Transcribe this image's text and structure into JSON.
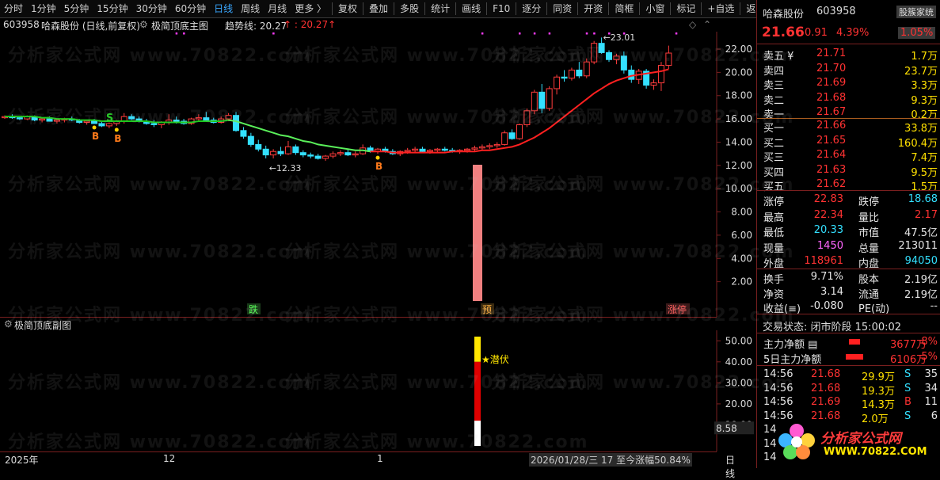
{
  "toolbar": {
    "items": [
      "分时",
      "1分钟",
      "5分钟",
      "15分钟",
      "30分钟",
      "60分钟",
      "日线",
      "周线",
      "月线",
      "更多 〉",
      "复权",
      "叠加",
      "多股",
      "统计",
      "画线",
      "F10",
      "逐分",
      "同资",
      "开资",
      "简框",
      "小窗",
      "标记",
      "+自选",
      "返回"
    ],
    "active_index": 6
  },
  "main_header": {
    "code": "603958",
    "name": "哈森股份 (日线,前复权)",
    "indicator": "极简顶底主图",
    "line_label": "趋势线: 20.27",
    "line_value": "↑ : 20.27↑"
  },
  "chart_data": [
    {
      "type": "candlestick",
      "title": "极简顶底主图",
      "ylim": [
        0,
        23.5
      ],
      "y_ticks": [
        "22.00",
        "20.00",
        "18.00",
        "16.00",
        "14.00",
        "12.00",
        "10.00",
        "8.00",
        "6.00",
        "4.00",
        "2.00"
      ],
      "y_tick_values": [
        22,
        20,
        18,
        16,
        14,
        12,
        10,
        8,
        6,
        4,
        2
      ],
      "candles": [
        [
          16.1,
          16.3,
          16.0,
          16.2
        ],
        [
          16.2,
          16.4,
          16.0,
          16.1
        ],
        [
          16.1,
          16.2,
          15.9,
          16.0
        ],
        [
          16.0,
          16.3,
          15.9,
          16.2
        ],
        [
          16.2,
          16.3,
          15.8,
          15.9
        ],
        [
          15.9,
          16.1,
          15.7,
          16.0
        ],
        [
          16.0,
          16.2,
          15.8,
          15.8
        ],
        [
          15.8,
          16.0,
          15.6,
          15.9
        ],
        [
          15.9,
          16.1,
          15.7,
          16.0
        ],
        [
          16.0,
          16.2,
          15.8,
          15.9
        ],
        [
          15.9,
          16.0,
          15.6,
          15.7
        ],
        [
          15.7,
          15.9,
          15.5,
          15.8
        ],
        [
          15.8,
          16.0,
          15.6,
          15.6
        ],
        [
          15.6,
          15.8,
          15.3,
          15.4
        ],
        [
          15.4,
          15.7,
          15.2,
          15.6
        ],
        [
          15.6,
          15.9,
          15.4,
          15.8
        ],
        [
          15.8,
          16.5,
          15.6,
          16.2
        ],
        [
          16.2,
          16.4,
          15.9,
          16.0
        ],
        [
          16.0,
          16.2,
          15.7,
          15.8
        ],
        [
          15.8,
          16.0,
          15.5,
          15.6
        ],
        [
          15.6,
          15.9,
          15.3,
          15.5
        ],
        [
          15.5,
          15.8,
          15.2,
          15.7
        ],
        [
          15.7,
          16.4,
          15.5,
          15.9
        ],
        [
          15.9,
          16.2,
          15.6,
          15.8
        ],
        [
          15.8,
          16.0,
          15.5,
          15.6
        ],
        [
          15.6,
          16.1,
          15.5,
          16.0
        ],
        [
          16.0,
          16.4,
          15.8,
          16.1
        ],
        [
          16.1,
          16.6,
          15.9,
          15.9
        ],
        [
          15.9,
          16.1,
          15.6,
          15.7
        ],
        [
          15.7,
          16.2,
          15.6,
          16.0
        ],
        [
          16.0,
          16.5,
          15.8,
          16.3
        ],
        [
          16.3,
          16.6,
          14.9,
          15.0
        ],
        [
          15.0,
          15.3,
          14.3,
          14.5
        ],
        [
          14.5,
          14.8,
          13.6,
          13.8
        ],
        [
          13.8,
          14.2,
          13.2,
          13.4
        ],
        [
          13.4,
          13.7,
          12.6,
          12.9
        ],
        [
          12.9,
          13.4,
          12.6,
          13.2
        ],
        [
          13.2,
          13.6,
          12.8,
          13.0
        ],
        [
          13.0,
          14.1,
          12.9,
          13.6
        ],
        [
          13.6,
          13.8,
          12.9,
          13.1
        ],
        [
          13.1,
          13.3,
          12.7,
          12.9
        ],
        [
          12.9,
          13.1,
          12.6,
          12.8
        ],
        [
          12.8,
          13.0,
          12.5,
          12.6
        ],
        [
          12.6,
          12.9,
          12.4,
          12.8
        ],
        [
          12.8,
          13.2,
          12.6,
          13.0
        ],
        [
          13.0,
          13.3,
          12.8,
          13.1
        ],
        [
          13.1,
          13.4,
          12.8,
          12.9
        ],
        [
          12.9,
          13.2,
          12.7,
          13.0
        ],
        [
          13.0,
          13.8,
          12.9,
          13.5
        ],
        [
          13.5,
          13.7,
          13.1,
          13.2
        ],
        [
          13.2,
          13.5,
          13.0,
          13.4
        ],
        [
          13.4,
          13.6,
          13.1,
          13.2
        ],
        [
          13.2,
          13.4,
          12.9,
          13.0
        ],
        [
          13.0,
          13.3,
          12.8,
          13.2
        ],
        [
          13.2,
          13.5,
          13.0,
          13.3
        ],
        [
          13.3,
          13.6,
          13.1,
          13.4
        ],
        [
          13.4,
          13.6,
          13.1,
          13.2
        ],
        [
          13.2,
          13.4,
          13.0,
          13.3
        ],
        [
          13.3,
          13.5,
          13.1,
          13.4
        ],
        [
          13.4,
          13.6,
          13.2,
          13.3
        ],
        [
          13.3,
          13.5,
          13.1,
          13.2
        ],
        [
          13.2,
          13.4,
          13.0,
          13.3
        ],
        [
          13.3,
          13.5,
          13.1,
          13.4
        ],
        [
          13.4,
          13.7,
          13.2,
          13.5
        ],
        [
          13.5,
          13.8,
          13.3,
          13.6
        ],
        [
          13.6,
          13.9,
          13.4,
          13.7
        ],
        [
          13.7,
          14.0,
          13.5,
          13.8
        ],
        [
          13.8,
          15.0,
          13.7,
          14.8
        ],
        [
          14.8,
          15.1,
          14.2,
          14.3
        ],
        [
          14.3,
          15.6,
          14.2,
          15.5
        ],
        [
          15.5,
          16.9,
          15.3,
          16.7
        ],
        [
          16.7,
          18.5,
          16.4,
          18.3
        ],
        [
          18.3,
          19.0,
          16.5,
          16.9
        ],
        [
          16.9,
          18.8,
          16.7,
          18.6
        ],
        [
          18.6,
          19.8,
          18.1,
          19.6
        ],
        [
          19.6,
          20.2,
          19.2,
          19.5
        ],
        [
          19.5,
          20.4,
          19.3,
          20.2
        ],
        [
          20.2,
          20.9,
          19.5,
          19.7
        ],
        [
          19.7,
          21.2,
          19.5,
          20.9
        ],
        [
          20.9,
          22.7,
          20.7,
          22.5
        ],
        [
          22.5,
          23.0,
          21.6,
          21.7
        ],
        [
          21.7,
          21.9,
          20.9,
          21.1
        ],
        [
          21.1,
          21.6,
          20.7,
          21.4
        ],
        [
          21.4,
          21.8,
          19.9,
          20.2
        ],
        [
          20.2,
          20.6,
          19.1,
          19.4
        ],
        [
          19.4,
          20.3,
          19.0,
          20.1
        ],
        [
          20.1,
          20.3,
          18.6,
          18.9
        ],
        [
          18.9,
          19.4,
          18.5,
          19.1
        ],
        [
          19.1,
          20.9,
          18.4,
          20.6
        ],
        [
          20.6,
          22.3,
          20.3,
          21.66
        ]
      ],
      "trend_line": [
        16.2,
        16.2,
        16.2,
        16.2,
        16.2,
        16.1,
        16.1,
        16.0,
        16.0,
        16.0,
        15.9,
        15.9,
        15.9,
        15.8,
        15.8,
        15.8,
        15.8,
        15.8,
        15.8,
        15.8,
        15.7,
        15.7,
        15.7,
        15.7,
        15.7,
        15.7,
        15.8,
        15.8,
        15.8,
        15.8,
        15.9,
        15.8,
        15.6,
        15.4,
        15.2,
        15.0,
        14.8,
        14.6,
        14.5,
        14.3,
        14.1,
        14.0,
        13.8,
        13.7,
        13.6,
        13.5,
        13.4,
        13.3,
        13.3,
        13.2,
        13.2,
        13.2,
        13.1,
        13.1,
        13.1,
        13.1,
        13.1,
        13.1,
        13.1,
        13.1,
        13.2,
        13.2,
        13.2,
        13.2,
        13.3,
        13.3,
        13.4,
        13.5,
        13.6,
        13.8,
        14.1,
        14.4,
        14.8,
        15.2,
        15.7,
        16.2,
        16.7,
        17.2,
        17.7,
        18.2,
        18.6,
        19.0,
        19.3,
        19.5,
        19.7,
        19.8,
        19.9,
        20.0,
        20.1,
        20.27
      ],
      "trend_color_switch": [
        31,
        49
      ],
      "annotations": {
        "high_label": "23.01",
        "low_label": "12.33",
        "b_signals": [
          12,
          15,
          50
        ],
        "s_signal": 14
      }
    },
    {
      "type": "bar",
      "title": "极简顶底副图",
      "ylim": [
        0,
        55
      ],
      "y_ticks": [
        "50.00",
        "40.00",
        "30.00",
        "20.00",
        "10.00"
      ],
      "y_tick_values": [
        50,
        40,
        30,
        20,
        10
      ],
      "current_value": "8.58",
      "label": "★潜伏"
    }
  ],
  "markers": {
    "die": "跌",
    "yu": "预",
    "zhangting": "涨停"
  },
  "sub_header": {
    "indicator": "极简顶底副图"
  },
  "bottom": {
    "year": "2025年",
    "mark12": "12",
    "mark1": "1",
    "info": "2026/01/28/三 17 至今涨幅50.84%",
    "period": "日线"
  },
  "right_panel": {
    "name": "哈森股份",
    "code": "603958",
    "tag": "股簇家统",
    "price": "21.66",
    "change": "0.91",
    "pct": "4.39%",
    "wb": "1.05%",
    "asks": [
      {
        "label": "卖五 ¥",
        "price": "21.71",
        "vol": "1.7万"
      },
      {
        "label": "卖四",
        "price": "21.70",
        "vol": "23.7万"
      },
      {
        "label": "卖三",
        "price": "21.69",
        "vol": "3.3万"
      },
      {
        "label": "卖二",
        "price": "21.68",
        "vol": "9.3万"
      },
      {
        "label": "卖一",
        "price": "21.67",
        "vol": "0.2万"
      }
    ],
    "bids": [
      {
        "label": "买一",
        "price": "21.66",
        "vol": "33.8万"
      },
      {
        "label": "买二",
        "price": "21.65",
        "vol": "160.4万"
      },
      {
        "label": "买三",
        "price": "21.64",
        "vol": "7.4万"
      },
      {
        "label": "买四",
        "price": "21.63",
        "vol": "9.5万"
      },
      {
        "label": "买五",
        "price": "21.62",
        "vol": "1.5万"
      }
    ],
    "stats1": [
      {
        "k1": "涨停",
        "v1": "22.83",
        "k2": "跌停",
        "v2": "18.68"
      },
      {
        "k1": "最高",
        "v1": "22.34",
        "k2": "量比",
        "v2": "2.17"
      },
      {
        "k1": "最低",
        "v1": "20.33",
        "k2": "市值",
        "v2": "47.5亿"
      },
      {
        "k1": "现量",
        "v1": "1450",
        "k2": "总量",
        "v2": "213011"
      },
      {
        "k1": "外盘",
        "v1": "118961",
        "k2": "内盘",
        "v2": "94050"
      }
    ],
    "stats2": [
      {
        "k1": "换手",
        "v1": "9.71%",
        "k2": "股本",
        "v2": "2.19亿"
      },
      {
        "k1": "净资",
        "v1": "3.14",
        "k2": "流通",
        "v2": "2.19亿"
      },
      {
        "k1": "收益(≡)",
        "v1": "-0.080",
        "k2": "PE(动)",
        "v2": "--"
      }
    ],
    "status": "交易状态: 闭市阶段 15:00:02",
    "flows": [
      {
        "label": "主力净额",
        "val": "3677万",
        "pct": "8%"
      },
      {
        "label": "5日主力净额",
        "val": "6106万",
        "pct": "5%"
      }
    ],
    "ticks": [
      {
        "t": "14:56",
        "p": "21.68",
        "v": "29.9万",
        "f": "S",
        "n": "35"
      },
      {
        "t": "14:56",
        "p": "21.68",
        "v": "19.3万",
        "f": "S",
        "n": "34"
      },
      {
        "t": "14:56",
        "p": "21.69",
        "v": "14.3万",
        "f": "B",
        "n": "11"
      },
      {
        "t": "14:56",
        "p": "21.68",
        "v": "2.0万",
        "f": "S",
        "n": "6"
      },
      {
        "t": "14",
        "p": "",
        "v": "",
        "f": "",
        "n": ""
      },
      {
        "t": "14",
        "p": "",
        "v": "",
        "f": "",
        "n": ""
      },
      {
        "t": "14",
        "p": "",
        "v": "",
        "f": "",
        "n": ""
      }
    ],
    "logo_text": "分析家公式网",
    "logo_url": "WWW.70822.COM"
  },
  "watermark": "分析家公式网 www.70822.com"
}
